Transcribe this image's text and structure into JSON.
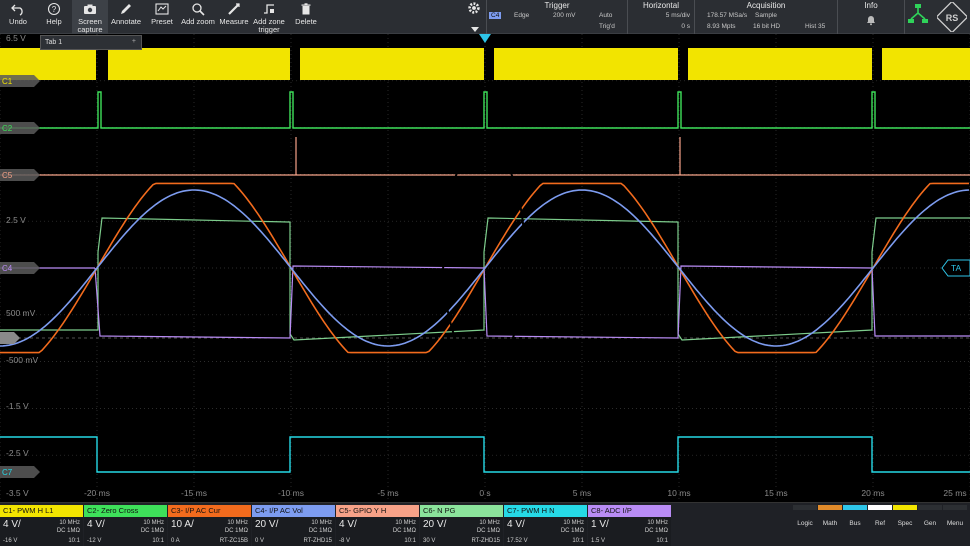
{
  "toolbar": {
    "buttons": [
      {
        "label": "Undo",
        "icon": "undo-icon"
      },
      {
        "label": "Help",
        "icon": "help-icon"
      },
      {
        "label": "Screen capture",
        "icon": "camera-icon"
      },
      {
        "label": "Annotate",
        "icon": "pen-icon"
      },
      {
        "label": "Preset",
        "icon": "preset-icon"
      },
      {
        "label": "Add zoom",
        "icon": "zoom-icon"
      },
      {
        "label": "Measure",
        "icon": "ruler-icon"
      },
      {
        "label": "Add zone trigger",
        "icon": "zone-trigger-icon"
      },
      {
        "label": "Delete",
        "icon": "trash-icon"
      }
    ]
  },
  "header": {
    "trigger": {
      "title": "Trigger",
      "source": "C4",
      "type": "Edge",
      "level": "200 mV",
      "mode": "Auto",
      "state": "Trig'd"
    },
    "horizontal": {
      "title": "Horizontal",
      "scale": "5 ms/div",
      "position": "0 s"
    },
    "acquisition": {
      "title": "Acquisition",
      "rate": "178.57 MSa/s",
      "mode": "Sample",
      "points": "8.93 Mpts",
      "resolution": "16 bit HD",
      "hist": "Hist 35"
    },
    "info": {
      "title": "Info"
    }
  },
  "tab": {
    "label": "Tab 1",
    "add": "+"
  },
  "y_labels": [
    "6.5 V",
    "2.5 V",
    "500 mV",
    "-500 mV",
    "-1.5 V",
    "-2.5 V",
    "-3.5 V"
  ],
  "channel_markers": [
    "C1",
    "C2",
    "C5",
    "C4",
    "C7"
  ],
  "trigger_marker": "TA",
  "time_labels": [
    "-20 ms",
    "-15 ms",
    "-10 ms",
    "-5 ms",
    "0 s",
    "5 ms",
    "10 ms",
    "15 ms",
    "20 ms",
    "25 ms"
  ],
  "channels": [
    {
      "label": "C1- PWM H L1",
      "color": "#f2e400",
      "scale": "4 V/",
      "bw": "10 MHz",
      "coupling": "DC 1MΩ",
      "offset": "-16 V",
      "probe": "10:1"
    },
    {
      "label": "C2- Zero Cross",
      "color": "#3ee05a",
      "scale": "4 V/",
      "bw": "10 MHz",
      "coupling": "DC 1MΩ",
      "offset": "-12 V",
      "probe": "10:1"
    },
    {
      "label": "C3- I/P AC Cur",
      "color": "#f26b1d",
      "scale": "10 A/",
      "bw": "10 MHz",
      "coupling": "DC 1MΩ",
      "offset": "0 A",
      "probe": "RT-ZC15B"
    },
    {
      "label": "C4- I/P AC Vol",
      "color": "#7d9cf0",
      "scale": "20 V/",
      "bw": "10 MHz",
      "coupling": "DC 1MΩ",
      "offset": "0 V",
      "probe": "RT-ZHD15"
    },
    {
      "label": "C5- GPIO Y H",
      "color": "#f7a288",
      "scale": "4 V/",
      "bw": "10 MHz",
      "coupling": "DC 1MΩ",
      "offset": "-8 V",
      "probe": "10:1"
    },
    {
      "label": "C6- N PG",
      "color": "#8be39b",
      "scale": "20 V/",
      "bw": "10 MHz",
      "coupling": "DC 1MΩ",
      "offset": "30 V",
      "probe": "RT-ZHD15"
    },
    {
      "label": "C7- PWM H N",
      "color": "#26d9e6",
      "scale": "4 V/",
      "bw": "10 MHz",
      "coupling": "DC 1MΩ",
      "offset": "17.52 V",
      "probe": "10:1"
    },
    {
      "label": "C8- ADC I/P",
      "color": "#b98cf5",
      "scale": "1 V/",
      "bw": "10 MHz",
      "coupling": "DC 1MΩ",
      "offset": "1.5 V",
      "probe": "10:1"
    }
  ],
  "right_buttons": [
    {
      "label": "Logic",
      "color": "#2c2f33"
    },
    {
      "label": "Math",
      "color": "#e08a2a"
    },
    {
      "label": "Bus",
      "color": "#2ec5e8"
    },
    {
      "label": "Ref",
      "color": "#ffffff"
    },
    {
      "label": "Spec",
      "color": "#f2e400"
    },
    {
      "label": "Gen",
      "color": "#2c2f33"
    },
    {
      "label": "Menu",
      "color": "#2c2f33"
    }
  ],
  "colors": {
    "background": "#000000",
    "grid": "#3a3a3a",
    "ch1": "#f2e400",
    "ch2": "#3ee05a",
    "ch3": "#f26b1d",
    "ch4": "#7d9cf0",
    "ch5": "#f7a288",
    "ch6": "#8be39b",
    "ch7": "#26d9e6",
    "ch8": "#b98cf5"
  }
}
